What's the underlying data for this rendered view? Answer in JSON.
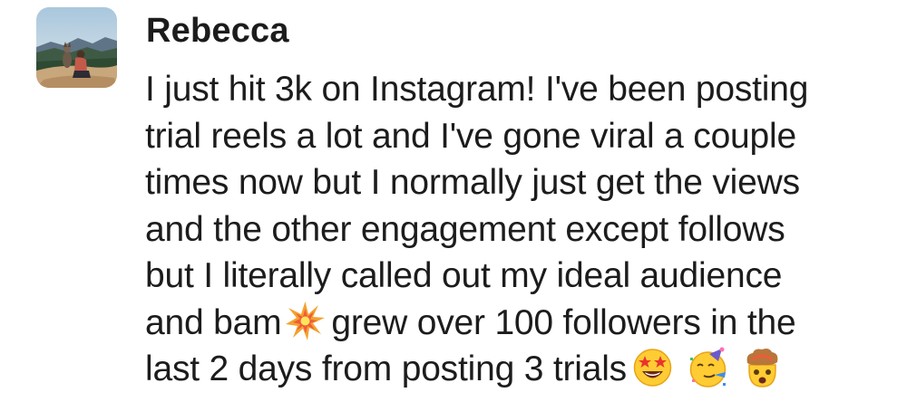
{
  "message": {
    "sender": "Rebecca",
    "lines": [
      "I just hit 3k on Instagram! I've been posting",
      "trial reels a lot and I've gone viral a couple",
      "times now but I normally just get the views",
      "and the other engagement except follows",
      "but I literally called out my ideal audience"
    ],
    "line6": {
      "before": "and bam",
      "emoji": "collision-icon",
      "after": "grew over 100 followers in the"
    },
    "line7": {
      "text": "last 2 days from posting 3 trials",
      "emojis": [
        "star-struck-icon",
        "partying-face-icon",
        "exploding-head-icon"
      ]
    }
  },
  "colors": {
    "text": "#1d1c1d",
    "background": "#ffffff"
  }
}
